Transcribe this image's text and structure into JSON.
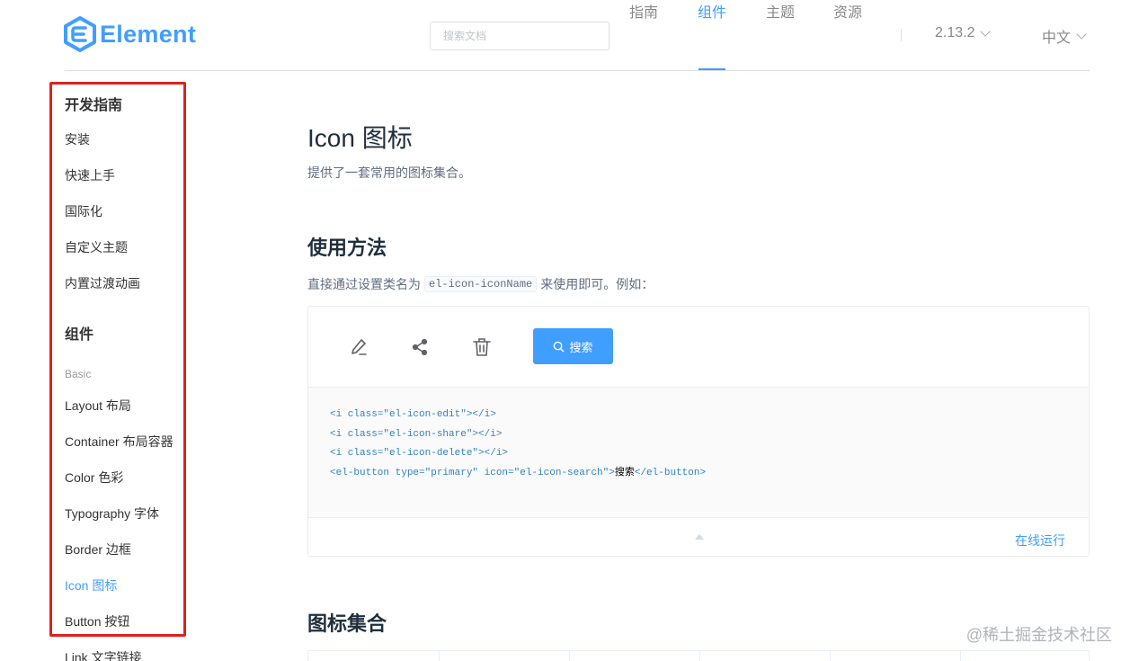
{
  "header": {
    "logo_text": "Element",
    "search_placeholder": "搜索文档",
    "nav": [
      {
        "label": "指南",
        "active": false
      },
      {
        "label": "组件",
        "active": true
      },
      {
        "label": "主题",
        "active": false
      },
      {
        "label": "资源",
        "active": false
      }
    ],
    "version": "2.13.2",
    "language": "中文"
  },
  "sidebar": {
    "guide_title": "开发指南",
    "guide_items": [
      "安装",
      "快速上手",
      "国际化",
      "自定义主题",
      "内置过渡动画"
    ],
    "components_title": "组件",
    "basic_label": "Basic",
    "component_items": [
      "Layout 布局",
      "Container 布局容器",
      "Color 色彩",
      "Typography 字体",
      "Border 边框",
      "Icon 图标",
      "Button 按钮",
      "Link 文字链接"
    ],
    "active_item": "Icon 图标",
    "highlight_color": "#e02020"
  },
  "main": {
    "title": "Icon 图标",
    "description": "提供了一套常用的图标集合。",
    "usage_title": "使用方法",
    "usage_desc_before": "直接通过设置类名为",
    "usage_code": "el-icon-iconName",
    "usage_desc_after": "来使用即可。例如：",
    "demo": {
      "icons": [
        "edit-icon",
        "share-icon",
        "delete-icon"
      ],
      "button_label": "搜索",
      "code": [
        {
          "open": "<i class=\"el-icon-edit\"></i>",
          "text": "",
          "close": ""
        },
        {
          "open": "<i class=\"el-icon-share\"></i>",
          "text": "",
          "close": ""
        },
        {
          "open": "<i class=\"el-icon-delete\"></i>",
          "text": "",
          "close": ""
        },
        {
          "open": "<el-button type=\"primary\" icon=\"el-icon-search\">",
          "text": "搜索",
          "close": "</el-button>"
        }
      ],
      "run_label": "在线运行"
    },
    "collection_title": "图标集合"
  },
  "watermark": "@稀土掘金技术社区",
  "colors": {
    "primary": "#409eff",
    "text": "#1f2f3d"
  }
}
